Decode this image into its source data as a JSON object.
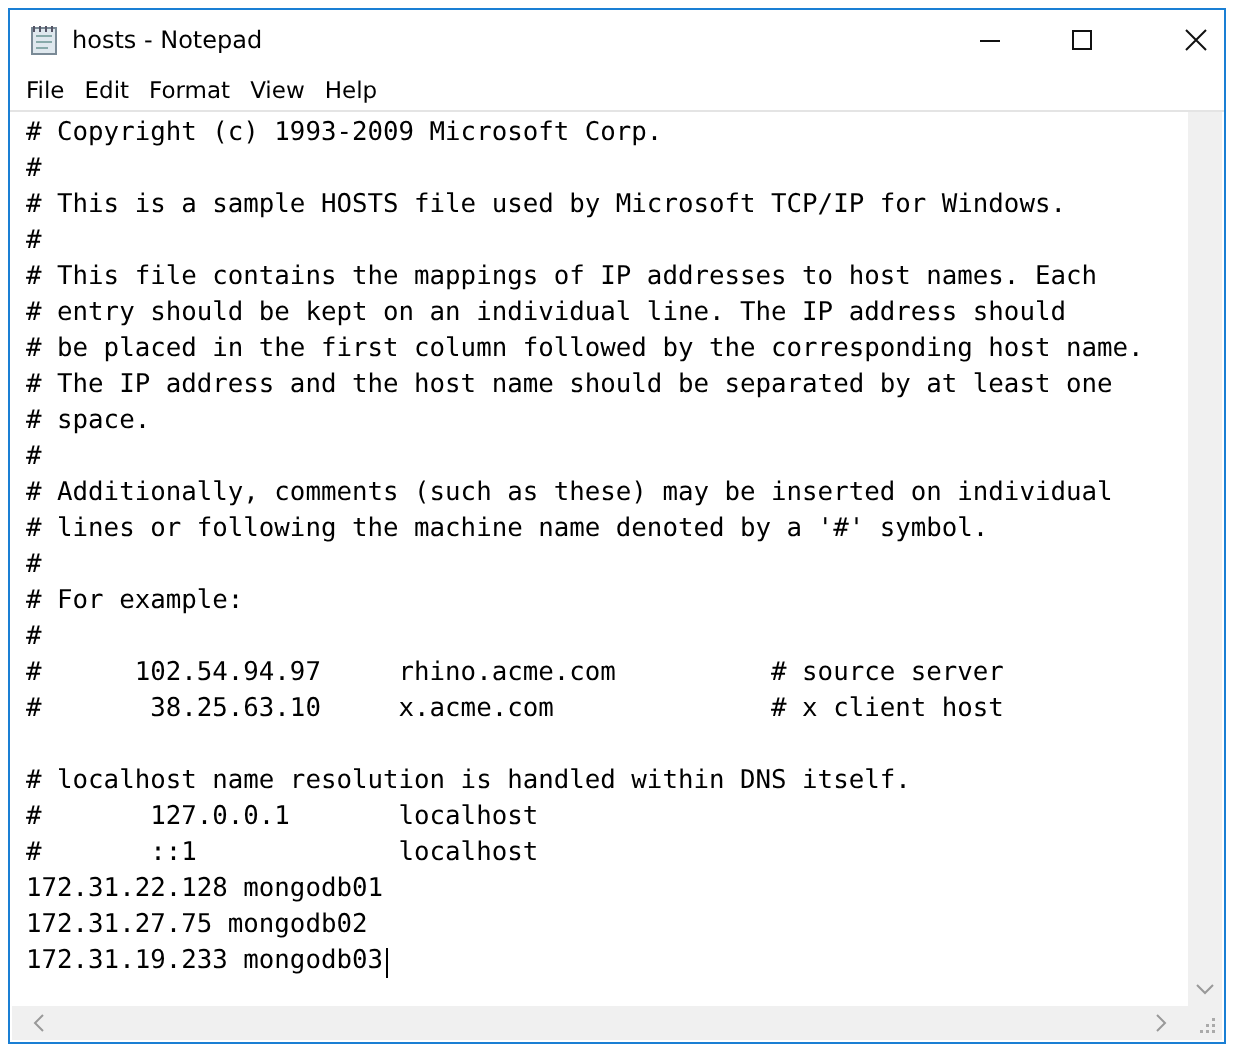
{
  "window": {
    "title": "hosts - Notepad"
  },
  "menu": [
    "File",
    "Edit",
    "Format",
    "View",
    "Help"
  ],
  "editor": {
    "lines": [
      {
        "kind": "text",
        "text": "# Copyright (c) 1993-2009 Microsoft Corp."
      },
      {
        "kind": "text",
        "text": "#"
      },
      {
        "kind": "text",
        "text": "# This is a sample HOSTS file used by Microsoft TCP/IP for Windows."
      },
      {
        "kind": "text",
        "text": "#"
      },
      {
        "kind": "text",
        "text": "# This file contains the mappings of IP addresses to host names. Each"
      },
      {
        "kind": "text",
        "text": "# entry should be kept on an individual line. The IP address should"
      },
      {
        "kind": "text",
        "text": "# be placed in the first column followed by the corresponding host name."
      },
      {
        "kind": "text",
        "text": "# The IP address and the host name should be separated by at least one"
      },
      {
        "kind": "text",
        "text": "# space."
      },
      {
        "kind": "text",
        "text": "#"
      },
      {
        "kind": "text",
        "text": "# Additionally, comments (such as these) may be inserted on individual"
      },
      {
        "kind": "text",
        "text": "# lines or following the machine name denoted by a '#' symbol."
      },
      {
        "kind": "text",
        "text": "#"
      },
      {
        "kind": "text",
        "text": "# For example:"
      },
      {
        "kind": "text",
        "text": "#"
      },
      {
        "kind": "text",
        "text": "#      102.54.94.97     rhino.acme.com          # source server"
      },
      {
        "kind": "text",
        "text": "#       38.25.63.10     x.acme.com              # x client host"
      },
      {
        "kind": "blank"
      },
      {
        "kind": "text",
        "text": "# localhost name resolution is handled within DNS itself."
      },
      {
        "kind": "text",
        "text": "#       127.0.0.1       localhost"
      },
      {
        "kind": "text",
        "text": "#       ::1             localhost"
      },
      {
        "kind": "text",
        "text": "172.31.22.128 mongodb01"
      },
      {
        "kind": "text",
        "text": "172.31.27.75 mongodb02"
      },
      {
        "kind": "caret",
        "text": "172.31.19.233 mongodb03"
      }
    ]
  }
}
